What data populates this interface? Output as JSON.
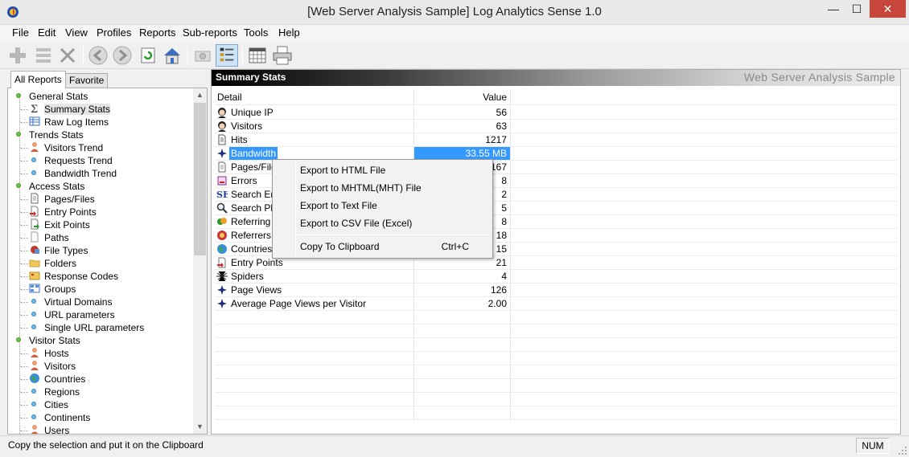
{
  "window": {
    "title": "[Web Server Analysis Sample] Log Analytics Sense 1.0",
    "min_glyph": "—",
    "max_glyph": "☐",
    "close_glyph": "✕"
  },
  "menu": [
    "File",
    "Edit",
    "View",
    "Profiles",
    "Reports",
    "Sub-reports",
    "Tools",
    "Help"
  ],
  "toolbar": {
    "buttons": [
      "add-icon",
      "list-icon",
      "delete-icon",
      "back-icon",
      "forward-icon",
      "refresh-icon",
      "home-icon",
      "camera-icon",
      "report-tree-icon",
      "calendar-icon",
      "print-icon"
    ]
  },
  "tabs": {
    "all_reports": "All Reports",
    "favorite": "Favorite"
  },
  "tree": [
    {
      "label": "General Stats",
      "level": 0,
      "icon": "bullet-green"
    },
    {
      "label": "Summary Stats",
      "level": 1,
      "icon": "sigma-icon",
      "selected": true
    },
    {
      "label": "Raw Log Items",
      "level": 1,
      "icon": "table-icon"
    },
    {
      "label": "Trends Stats",
      "level": 0,
      "icon": "bullet-green"
    },
    {
      "label": "Visitors Trend",
      "level": 1,
      "icon": "person-icon"
    },
    {
      "label": "Requests Trend",
      "level": 1,
      "icon": "bullet-blue"
    },
    {
      "label": "Bandwidth Trend",
      "level": 1,
      "icon": "bullet-blue"
    },
    {
      "label": "Access Stats",
      "level": 0,
      "icon": "bullet-green"
    },
    {
      "label": "Pages/Files",
      "level": 1,
      "icon": "page-icon"
    },
    {
      "label": "Entry Points",
      "level": 1,
      "icon": "entry-icon"
    },
    {
      "label": "Exit Points",
      "level": 1,
      "icon": "exit-icon"
    },
    {
      "label": "Paths",
      "level": 1,
      "icon": "path-icon"
    },
    {
      "label": "File Types",
      "level": 1,
      "icon": "filetype-icon"
    },
    {
      "label": "Folders",
      "level": 1,
      "icon": "folder-icon"
    },
    {
      "label": "Response Codes",
      "level": 1,
      "icon": "code-icon"
    },
    {
      "label": "Groups",
      "level": 1,
      "icon": "groups-icon"
    },
    {
      "label": "Virtual Domains",
      "level": 1,
      "icon": "bullet-blue"
    },
    {
      "label": "URL parameters",
      "level": 1,
      "icon": "bullet-blue"
    },
    {
      "label": "Single URL parameters",
      "level": 1,
      "icon": "bullet-blue"
    },
    {
      "label": "Visitor Stats",
      "level": 0,
      "icon": "bullet-green"
    },
    {
      "label": "Hosts",
      "level": 1,
      "icon": "person-icon"
    },
    {
      "label": "Visitors",
      "level": 1,
      "icon": "person-icon"
    },
    {
      "label": "Countries",
      "level": 1,
      "icon": "globe-icon"
    },
    {
      "label": "Regions",
      "level": 1,
      "icon": "bullet-blue"
    },
    {
      "label": "Cities",
      "level": 1,
      "icon": "bullet-blue"
    },
    {
      "label": "Continents",
      "level": 1,
      "icon": "bullet-blue"
    },
    {
      "label": "Users",
      "level": 1,
      "icon": "person-icon"
    }
  ],
  "report": {
    "title": "Summary Stats",
    "subtitle": "Web Server Analysis Sample",
    "columns": {
      "detail": "Detail",
      "value": "Value"
    },
    "rows": [
      {
        "detail": "Unique IP",
        "value": "56",
        "icon": "face-icon"
      },
      {
        "detail": "Visitors",
        "value": "63",
        "icon": "face-icon"
      },
      {
        "detail": "Hits",
        "value": "1217",
        "icon": "document-icon"
      },
      {
        "detail": "Bandwidth",
        "value": "33.55 MB",
        "icon": "star-icon",
        "selected": true
      },
      {
        "detail": "Pages/Files",
        "value": "167",
        "icon": "page-icon"
      },
      {
        "detail": "Errors",
        "value": "8",
        "icon": "error-icon"
      },
      {
        "detail": "Search Engines",
        "value": "2",
        "icon": "se-icon"
      },
      {
        "detail": "Search Phrases",
        "value": "5",
        "icon": "magnifier-icon"
      },
      {
        "detail": "Referring Sites",
        "value": "8",
        "icon": "referring-icon"
      },
      {
        "detail": "Referrers",
        "value": "18",
        "icon": "referrer-icon"
      },
      {
        "detail": "Countries",
        "value": "15",
        "icon": "globe-icon"
      },
      {
        "detail": "Entry Points",
        "value": "21",
        "icon": "entry-icon"
      },
      {
        "detail": "Spiders",
        "value": "4",
        "icon": "spider-icon"
      },
      {
        "detail": "Page Views",
        "value": "126",
        "icon": "star-icon"
      },
      {
        "detail": "Average Page Views per Visitor",
        "value": "2.00",
        "icon": "star-icon"
      }
    ]
  },
  "context_menu": {
    "items": [
      {
        "label": "Export to HTML File",
        "shortcut": ""
      },
      {
        "label": "Export to MHTML(MHT) File",
        "shortcut": ""
      },
      {
        "label": "Export to Text File",
        "shortcut": ""
      },
      {
        "label": "Export to CSV File (Excel)",
        "shortcut": ""
      },
      {
        "label": "Copy To Clipboard",
        "shortcut": "Ctrl+C"
      }
    ]
  },
  "status": {
    "text": "Copy the selection and put it on the Clipboard",
    "num": "NUM"
  },
  "colors": {
    "selection": "#3399ff",
    "close_button": "#c7463b"
  }
}
